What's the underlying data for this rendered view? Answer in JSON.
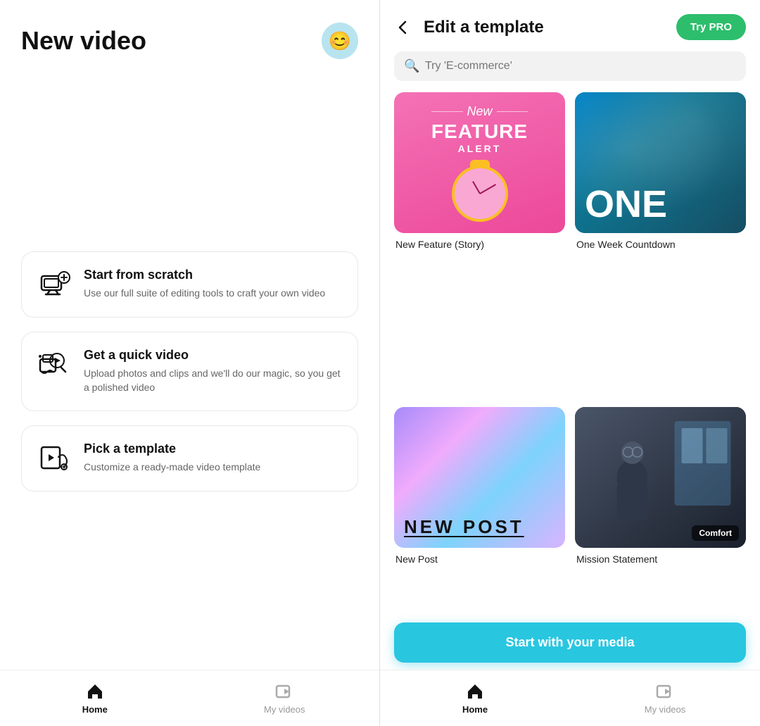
{
  "left": {
    "title": "New video",
    "avatar_emoji": "😊",
    "cards": [
      {
        "id": "scratch",
        "title": "Start from scratch",
        "description": "Use our full suite of editing tools to craft your own video"
      },
      {
        "id": "quick",
        "title": "Get a quick video",
        "description": "Upload photos and clips and we'll do our magic, so you get a polished video"
      },
      {
        "id": "template",
        "title": "Pick a template",
        "description": "Customize a ready-made video template"
      }
    ],
    "nav": {
      "home_label": "Home",
      "videos_label": "My videos"
    }
  },
  "right": {
    "back_label": "←",
    "title": "Edit a template",
    "try_pro_label": "Try PRO",
    "search_placeholder": "Try 'E-commerce'",
    "templates": [
      {
        "id": "new-feature",
        "name": "New Feature (Story)",
        "type": "pink"
      },
      {
        "id": "one-week",
        "name": "One Week Countdown",
        "type": "ocean"
      },
      {
        "id": "new-post",
        "name": "New Post",
        "type": "holographic"
      },
      {
        "id": "mission",
        "name": "Mission Statement",
        "type": "mission",
        "comfort_label": "Comfort"
      }
    ],
    "start_media_label": "Start with your media",
    "nav": {
      "home_label": "Home",
      "videos_label": "My videos"
    }
  }
}
